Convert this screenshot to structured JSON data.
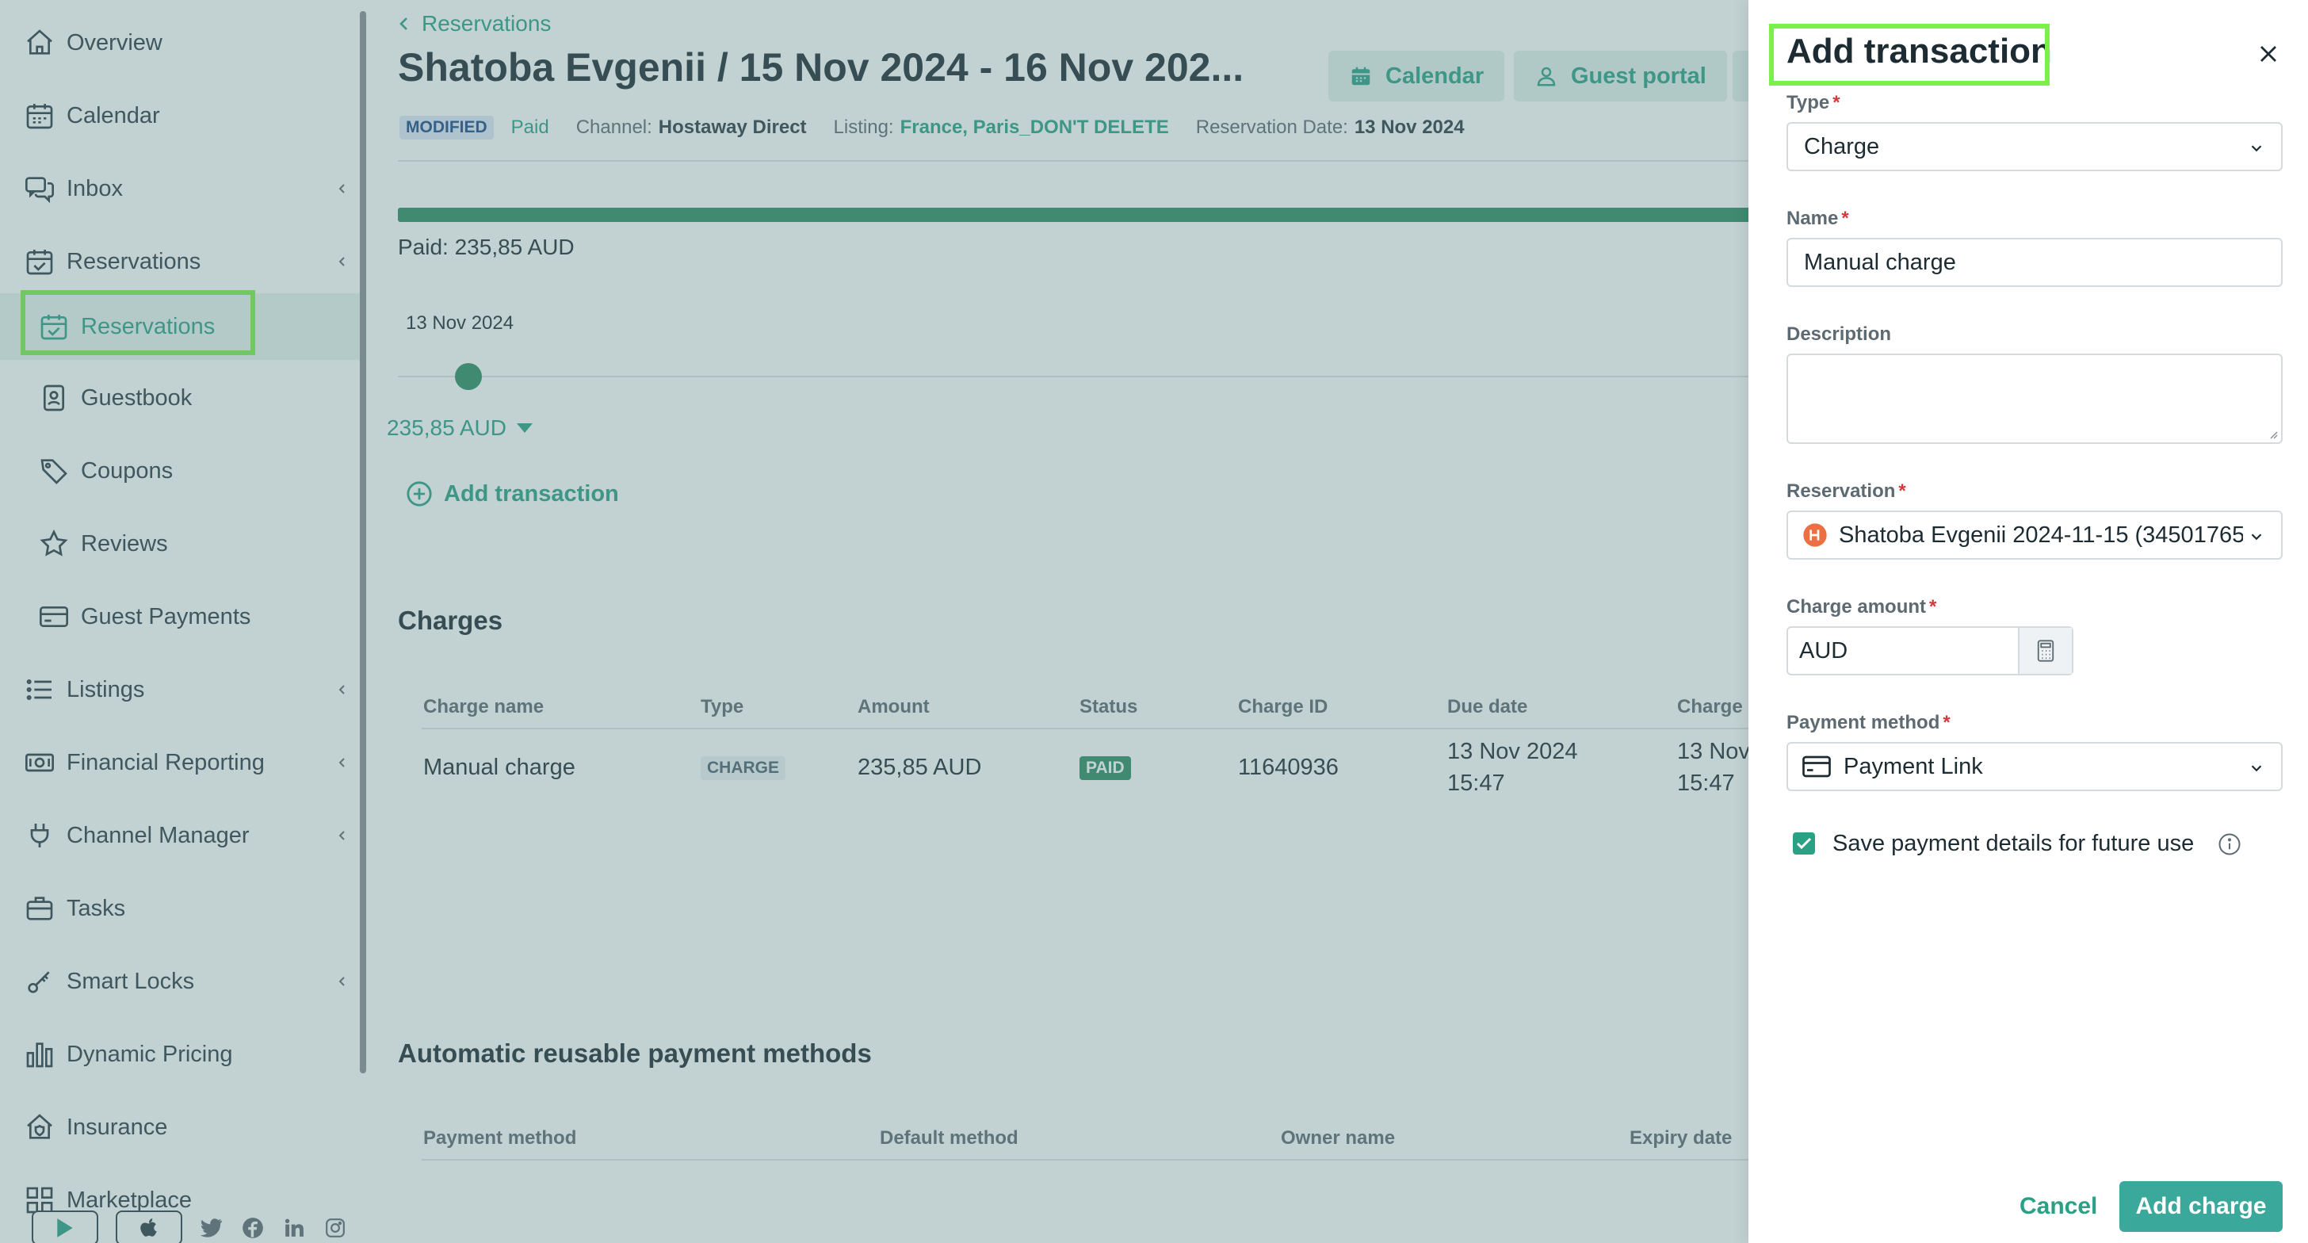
{
  "sidebar": {
    "items": [
      {
        "label": "Overview",
        "icon": "home-icon"
      },
      {
        "label": "Calendar",
        "icon": "calendar-icon"
      },
      {
        "label": "Inbox",
        "icon": "chat-icon"
      },
      {
        "label": "Reservations",
        "icon": "calendar-check-icon"
      },
      {
        "label": "Reservations",
        "icon": "calendar-check-icon"
      },
      {
        "label": "Guestbook",
        "icon": "contact-book-icon"
      },
      {
        "label": "Coupons",
        "icon": "tag-icon"
      },
      {
        "label": "Reviews",
        "icon": "star-icon"
      },
      {
        "label": "Guest Payments",
        "icon": "credit-card-icon"
      },
      {
        "label": "Listings",
        "icon": "list-icon"
      },
      {
        "label": "Financial Reporting",
        "icon": "banknote-icon"
      },
      {
        "label": "Channel Manager",
        "icon": "plug-icon"
      },
      {
        "label": "Tasks",
        "icon": "briefcase-icon"
      },
      {
        "label": "Smart Locks",
        "icon": "key-icon"
      },
      {
        "label": "Dynamic Pricing",
        "icon": "bar-chart-icon"
      },
      {
        "label": "Insurance",
        "icon": "house-shield-icon"
      },
      {
        "label": "Marketplace",
        "icon": "apps-icon"
      }
    ]
  },
  "header": {
    "breadcrumb": "Reservations",
    "title": "Shatoba Evgenii / 15 Nov 2024 - 16 Nov 202...",
    "calendar_button": "Calendar",
    "guest_portal_button": "Guest portal",
    "status_badge": "MODIFIED",
    "payment_status": "Paid",
    "channel_key": "Channel:",
    "channel_value": "Hostaway Direct",
    "listing_key": "Listing:",
    "listing_value": "France, Paris_DON'T DELETE",
    "reservation_date_key": "Reservation Date:",
    "reservation_date_value": "13 Nov 2024"
  },
  "payments": {
    "progress_percent": 100,
    "paid_label": "Paid: 235,85 AUD",
    "timeline_date": "13 Nov 2024",
    "amount_dropdown": "235,85 AUD",
    "add_transaction": "Add transaction"
  },
  "charges": {
    "title": "Charges",
    "columns": [
      "Charge name",
      "Type",
      "Amount",
      "Status",
      "Charge ID",
      "Due date",
      "Charge d"
    ],
    "rows": [
      {
        "name": "Manual charge",
        "type": "CHARGE",
        "amount": "235,85 AUD",
        "status": "PAID",
        "charge_id": "11640936",
        "due_date_line1": "13 Nov 2024",
        "due_date_line2": "15:47",
        "charge_date_line1": "13 Nov",
        "charge_date_line2": "15:47"
      }
    ]
  },
  "reusable": {
    "title": "Automatic reusable payment methods",
    "columns": [
      "Payment method",
      "Default method",
      "Owner name",
      "Expiry date"
    ]
  },
  "drawer": {
    "title": "Add transaction",
    "type_label": "Type",
    "type_value": "Charge",
    "name_label": "Name",
    "name_value": "Manual charge",
    "description_label": "Description",
    "description_value": "",
    "reservation_label": "Reservation",
    "reservation_value": "Shatoba Evgenii 2024-11-15 (34501765",
    "charge_amount_label": "Charge amount",
    "charge_amount_currency": "AUD",
    "payment_method_label": "Payment method",
    "payment_method_value": "Payment Link",
    "save_details_label": "Save payment details for future use",
    "save_details_checked": true,
    "required_marker": "*",
    "cancel_button": "Cancel",
    "submit_button": "Add charge"
  },
  "colors": {
    "accent": "#2aa085",
    "progress": "#2e8d64",
    "highlight": "#7cf04a",
    "overlay": "#5f8588",
    "required": "#d23b3b"
  }
}
